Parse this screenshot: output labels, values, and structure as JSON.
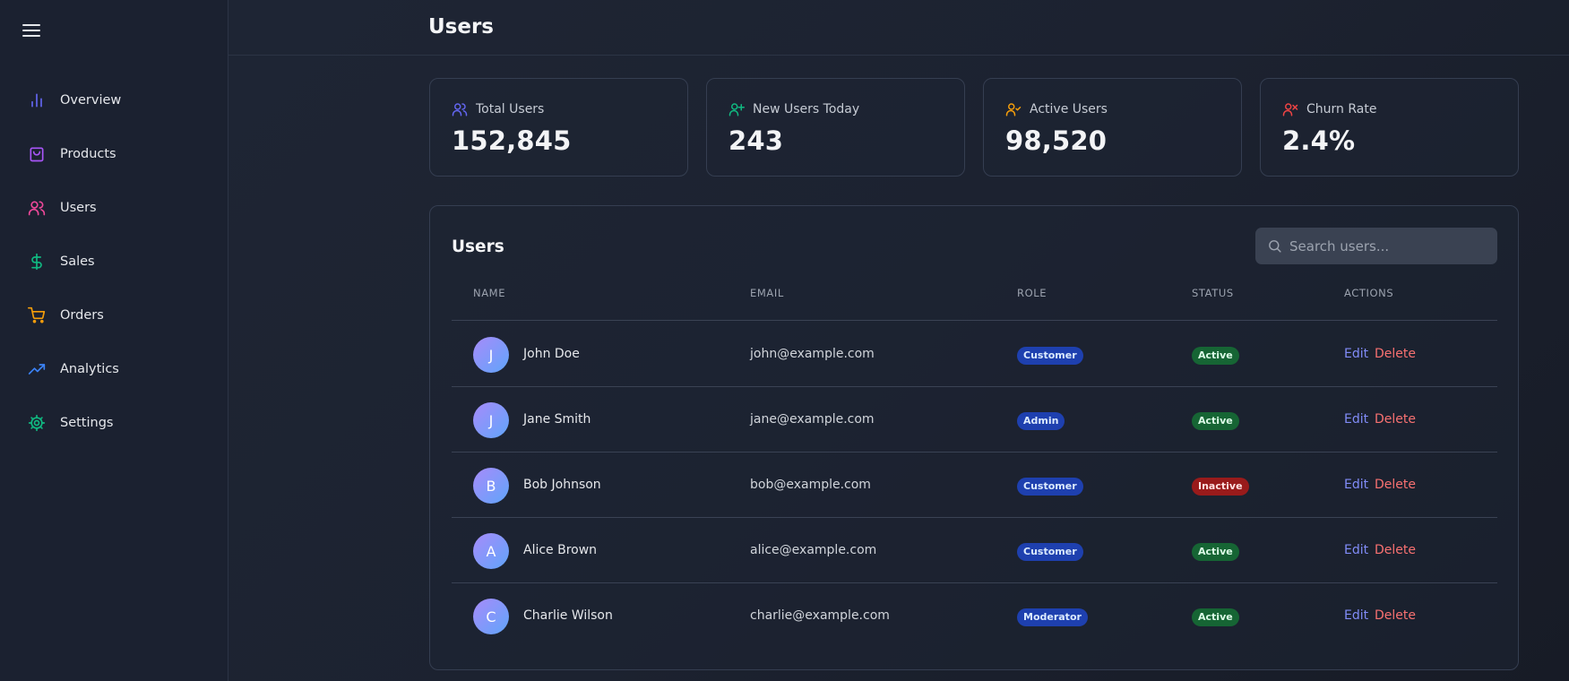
{
  "header": {
    "title": "Users"
  },
  "sidebar": {
    "items": [
      {
        "label": "Overview",
        "icon": "bar-chart-icon",
        "color": "#6366f1"
      },
      {
        "label": "Products",
        "icon": "shopping-bag-icon",
        "color": "#a855f7"
      },
      {
        "label": "Users",
        "icon": "users-icon",
        "color": "#ec4899"
      },
      {
        "label": "Sales",
        "icon": "dollar-sign-icon",
        "color": "#10b981"
      },
      {
        "label": "Orders",
        "icon": "shopping-cart-icon",
        "color": "#f59e0b"
      },
      {
        "label": "Analytics",
        "icon": "trending-up-icon",
        "color": "#3b82f6"
      },
      {
        "label": "Settings",
        "icon": "gear-icon",
        "color": "#10b981"
      }
    ]
  },
  "stats": [
    {
      "label": "Total Users",
      "value": "152,845",
      "icon": "users-icon",
      "color": "#6366f1"
    },
    {
      "label": "New Users Today",
      "value": "243",
      "icon": "user-plus-icon",
      "color": "#10b981"
    },
    {
      "label": "Active Users",
      "value": "98,520",
      "icon": "user-check-icon",
      "color": "#f59e0b"
    },
    {
      "label": "Churn Rate",
      "value": "2.4%",
      "icon": "user-x-icon",
      "color": "#ef4444"
    }
  ],
  "table": {
    "title": "Users",
    "search_placeholder": "Search users...",
    "columns": [
      "NAME",
      "EMAIL",
      "ROLE",
      "STATUS",
      "ACTIONS"
    ],
    "edit_label": "Edit",
    "delete_label": "Delete",
    "rows": [
      {
        "initial": "J",
        "name": "John Doe",
        "email": "john@example.com",
        "role": "Customer",
        "status": "Active"
      },
      {
        "initial": "J",
        "name": "Jane Smith",
        "email": "jane@example.com",
        "role": "Admin",
        "status": "Active"
      },
      {
        "initial": "B",
        "name": "Bob Johnson",
        "email": "bob@example.com",
        "role": "Customer",
        "status": "Inactive"
      },
      {
        "initial": "A",
        "name": "Alice Brown",
        "email": "alice@example.com",
        "role": "Customer",
        "status": "Active"
      },
      {
        "initial": "C",
        "name": "Charlie Wilson",
        "email": "charlie@example.com",
        "role": "Moderator",
        "status": "Active"
      }
    ]
  },
  "colors": {
    "accent": "#818cf8",
    "danger": "#f87171",
    "active_badge": "#166534",
    "inactive_badge": "#991b1b",
    "role_badge": "#1e40af"
  }
}
